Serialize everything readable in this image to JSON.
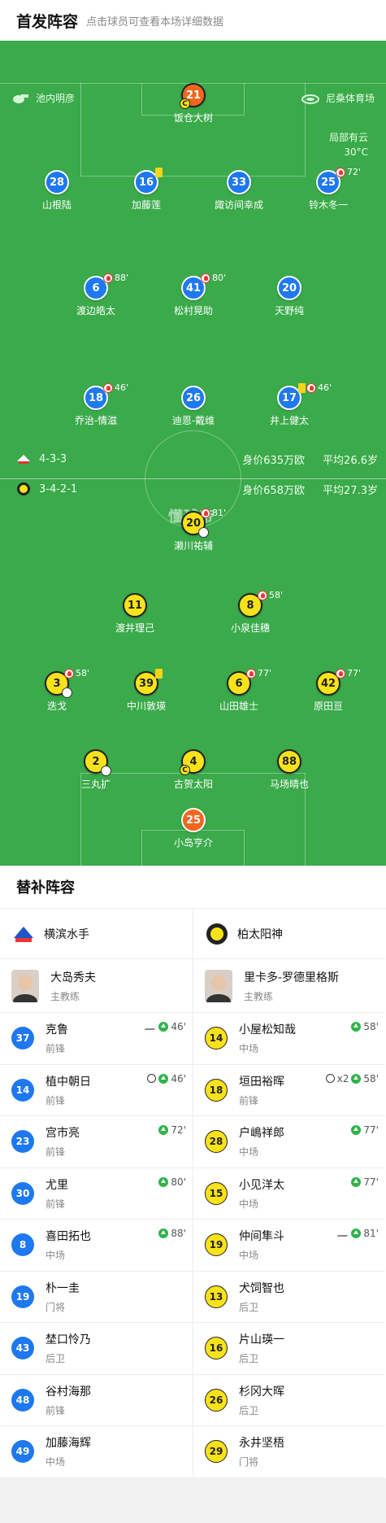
{
  "header": {
    "title": "首发阵容",
    "hint": "点击球员可查看本场详细数据"
  },
  "venue": {
    "referee": "池内明彦",
    "stadium": "尼桑体育场"
  },
  "weather": {
    "condition": "局部有云",
    "temp": "30°C"
  },
  "brand": "懂球帝",
  "home": {
    "formation": "4-3-3",
    "value": "身价635万欧",
    "age": "平均26.6岁"
  },
  "away": {
    "formation": "3-4-2-1",
    "value": "身价658万欧",
    "age": "平均27.3岁"
  },
  "pitch_players": [
    {
      "id": "p1",
      "num": "21",
      "name": "饭仓大树",
      "sub": "",
      "card": false,
      "cap": true,
      "ball": false
    },
    {
      "id": "p2",
      "num": "28",
      "name": "山根陆",
      "sub": "",
      "card": false,
      "cap": false,
      "ball": false
    },
    {
      "id": "p3",
      "num": "16",
      "name": "加藤莲",
      "sub": "",
      "card": true,
      "cap": false,
      "ball": false
    },
    {
      "id": "p4",
      "num": "33",
      "name": "諏访间幸成",
      "sub": "",
      "card": false,
      "cap": false,
      "ball": false
    },
    {
      "id": "p5",
      "num": "25",
      "name": "铃木冬一",
      "sub": "72'",
      "card": false,
      "cap": false,
      "ball": false
    },
    {
      "id": "p6",
      "num": "6",
      "name": "渡边皓太",
      "sub": "88'",
      "card": false,
      "cap": false,
      "ball": false
    },
    {
      "id": "p7",
      "num": "41",
      "name": "松村晃助",
      "sub": "80'",
      "card": false,
      "cap": false,
      "ball": false
    },
    {
      "id": "p8",
      "num": "20",
      "name": "天野纯",
      "sub": "",
      "card": false,
      "cap": false,
      "ball": false
    },
    {
      "id": "p9",
      "num": "18",
      "name": "乔治-情滋",
      "sub": "46'",
      "card": false,
      "cap": false,
      "ball": false
    },
    {
      "id": "p10",
      "num": "26",
      "name": "迪恩-戴维",
      "sub": "",
      "card": false,
      "cap": false,
      "ball": false
    },
    {
      "id": "p11",
      "num": "17",
      "name": "井上健太",
      "sub": "46'",
      "card": true,
      "cap": false,
      "ball": false
    },
    {
      "id": "a1",
      "num": "20",
      "name": "濑川祐辅",
      "sub": "81'",
      "card": false,
      "cap": false,
      "ball": true
    },
    {
      "id": "a2",
      "num": "11",
      "name": "渡井理己",
      "sub": "",
      "card": false,
      "cap": false,
      "ball": false
    },
    {
      "id": "a3",
      "num": "8",
      "name": "小泉佳穗",
      "sub": "58'",
      "card": false,
      "cap": false,
      "ball": false
    },
    {
      "id": "a4",
      "num": "3",
      "name": "迭戈",
      "sub": "58'",
      "card": false,
      "cap": false,
      "ball": true
    },
    {
      "id": "a5",
      "num": "39",
      "name": "中川敦瑛",
      "sub": "",
      "card": true,
      "cap": false,
      "ball": false
    },
    {
      "id": "a6",
      "num": "6",
      "name": "山田雄士",
      "sub": "77'",
      "card": false,
      "cap": false,
      "ball": false
    },
    {
      "id": "a7",
      "num": "42",
      "name": "原田亘",
      "sub": "77'",
      "card": false,
      "cap": false,
      "ball": false
    },
    {
      "id": "a8",
      "num": "2",
      "name": "三丸扩",
      "sub": "",
      "card": false,
      "cap": false,
      "ball": true
    },
    {
      "id": "a9",
      "num": "4",
      "name": "古贺太阳",
      "sub": "",
      "card": false,
      "cap": true,
      "ball": false
    },
    {
      "id": "a10",
      "num": "88",
      "name": "马场晴也",
      "sub": "",
      "card": false,
      "cap": false,
      "ball": false
    },
    {
      "id": "a11",
      "num": "25",
      "name": "小岛亨介",
      "sub": "",
      "card": false,
      "cap": false,
      "ball": false
    }
  ],
  "subs": {
    "title": "替补阵容",
    "home": {
      "team": "横滨水手",
      "coach": {
        "name": "大岛秀夫",
        "role": "主教练"
      },
      "players": [
        {
          "num": "37",
          "name": "克鲁",
          "pos": "前锋",
          "ev": "46'",
          "icons": "assist"
        },
        {
          "num": "14",
          "name": "植中朝日",
          "pos": "前锋",
          "ev": "46'",
          "icons": "ball"
        },
        {
          "num": "23",
          "name": "宫市亮",
          "pos": "前锋",
          "ev": "72'",
          "icons": ""
        },
        {
          "num": "30",
          "name": "尤里",
          "pos": "前锋",
          "ev": "80'",
          "icons": ""
        },
        {
          "num": "8",
          "name": "喜田拓也",
          "pos": "中场",
          "ev": "88'",
          "icons": ""
        },
        {
          "num": "19",
          "name": "朴一圭",
          "pos": "门将",
          "ev": "",
          "icons": ""
        },
        {
          "num": "43",
          "name": "埜口怜乃",
          "pos": "后卫",
          "ev": "",
          "icons": ""
        },
        {
          "num": "48",
          "name": "谷村海那",
          "pos": "前锋",
          "ev": "",
          "icons": ""
        },
        {
          "num": "49",
          "name": "加藤海辉",
          "pos": "中场",
          "ev": "",
          "icons": ""
        }
      ]
    },
    "away": {
      "team": "柏太阳神",
      "coach": {
        "name": "里卡多-罗德里格斯",
        "role": "主教练"
      },
      "players": [
        {
          "num": "14",
          "name": "小屋松知哉",
          "pos": "中场",
          "ev": "58'",
          "icons": ""
        },
        {
          "num": "18",
          "name": "垣田裕晖",
          "pos": "前锋",
          "ev": "58'",
          "icons": "ball2",
          "extra": "x2"
        },
        {
          "num": "28",
          "name": "户嶋祥郎",
          "pos": "中场",
          "ev": "77'",
          "icons": ""
        },
        {
          "num": "15",
          "name": "小见洋太",
          "pos": "中场",
          "ev": "77'",
          "icons": ""
        },
        {
          "num": "19",
          "name": "仲间隼斗",
          "pos": "中场",
          "ev": "81'",
          "icons": "assist"
        },
        {
          "num": "13",
          "name": "犬饲智也",
          "pos": "后卫",
          "ev": "",
          "icons": ""
        },
        {
          "num": "16",
          "name": "片山瑛一",
          "pos": "后卫",
          "ev": "",
          "icons": ""
        },
        {
          "num": "26",
          "name": "杉冈大晖",
          "pos": "后卫",
          "ev": "",
          "icons": ""
        },
        {
          "num": "29",
          "name": "永井坚梧",
          "pos": "门将",
          "ev": "",
          "icons": ""
        }
      ]
    }
  },
  "colors": {
    "pitch": "#3aaa4a",
    "home": "#1e78f0",
    "away": "#f8e21a",
    "keeper": "#f2661f"
  }
}
